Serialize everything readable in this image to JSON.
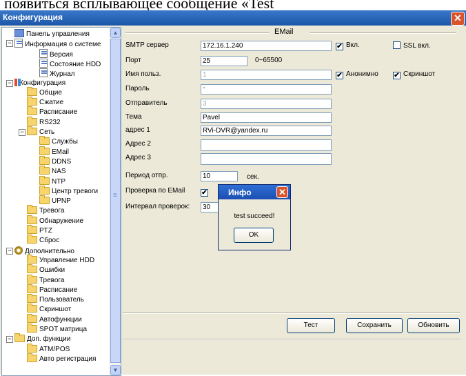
{
  "document_text": "появиться всплывающее сообщение «Test",
  "window": {
    "title": "Конфигурация",
    "close_glyph": "✕"
  },
  "tree": [
    {
      "label": "Панель управления",
      "level": 0,
      "icon": "panel-icon",
      "expander": ""
    },
    {
      "label": "Информация о системе",
      "level": 0,
      "icon": "doc-icon",
      "expander": "−"
    },
    {
      "label": "Версия",
      "level": 2,
      "icon": "doc-icon",
      "expander": ""
    },
    {
      "label": "Состояние HDD",
      "level": 2,
      "icon": "doc-icon",
      "expander": ""
    },
    {
      "label": "Журнал",
      "level": 2,
      "icon": "doc-icon",
      "expander": ""
    },
    {
      "label": "Конфигурация",
      "level": 0,
      "icon": "config-icon",
      "expander": "−"
    },
    {
      "label": "Общие",
      "level": 1,
      "icon": "folder",
      "expander": ""
    },
    {
      "label": "Сжатие",
      "level": 1,
      "icon": "folder",
      "expander": ""
    },
    {
      "label": "Расписание",
      "level": 1,
      "icon": "folder",
      "expander": ""
    },
    {
      "label": "RS232",
      "level": 1,
      "icon": "folder",
      "expander": ""
    },
    {
      "label": "Сеть",
      "level": 1,
      "icon": "folder",
      "expander": "−"
    },
    {
      "label": "Службы",
      "level": 2,
      "icon": "folder",
      "expander": ""
    },
    {
      "label": "EMail",
      "level": 2,
      "icon": "folder",
      "expander": ""
    },
    {
      "label": "DDNS",
      "level": 2,
      "icon": "folder",
      "expander": ""
    },
    {
      "label": "NAS",
      "level": 2,
      "icon": "folder",
      "expander": ""
    },
    {
      "label": "NTP",
      "level": 2,
      "icon": "folder",
      "expander": ""
    },
    {
      "label": "Центр тревоги",
      "level": 2,
      "icon": "folder",
      "expander": ""
    },
    {
      "label": "UPNP",
      "level": 2,
      "icon": "folder",
      "expander": ""
    },
    {
      "label": "Тревога",
      "level": 1,
      "icon": "folder",
      "expander": ""
    },
    {
      "label": "Обнаружение",
      "level": 1,
      "icon": "folder",
      "expander": ""
    },
    {
      "label": "PTZ",
      "level": 1,
      "icon": "folder",
      "expander": ""
    },
    {
      "label": "Сброс",
      "level": 1,
      "icon": "folder",
      "expander": ""
    },
    {
      "label": "Дополнительно",
      "level": 0,
      "icon": "gear-icon",
      "expander": "−"
    },
    {
      "label": "Управление HDD",
      "level": 1,
      "icon": "folder",
      "expander": ""
    },
    {
      "label": "Ошибки",
      "level": 1,
      "icon": "folder",
      "expander": ""
    },
    {
      "label": "Тревога",
      "level": 1,
      "icon": "folder",
      "expander": ""
    },
    {
      "label": "Расписание",
      "level": 1,
      "icon": "folder",
      "expander": ""
    },
    {
      "label": "Пользователь",
      "level": 1,
      "icon": "folder",
      "expander": ""
    },
    {
      "label": "Скриншот",
      "level": 1,
      "icon": "folder",
      "expander": ""
    },
    {
      "label": "Автофункции",
      "level": 1,
      "icon": "folder",
      "expander": ""
    },
    {
      "label": "SPOT матрица",
      "level": 1,
      "icon": "folder",
      "expander": ""
    },
    {
      "label": "Доп. функции",
      "level": 0,
      "icon": "folder",
      "expander": "−"
    },
    {
      "label": "ATM/POS",
      "level": 1,
      "icon": "folder",
      "expander": ""
    },
    {
      "label": "Авто регистрация",
      "level": 1,
      "icon": "folder",
      "expander": ""
    }
  ],
  "email": {
    "group_title": "EMail",
    "smtp": {
      "label": "SMTP сервер",
      "value": "172.16.1.240"
    },
    "port": {
      "label": "Порт",
      "value": "25",
      "hint": "0~65500"
    },
    "user": {
      "label": "Имя польз.",
      "value": "1"
    },
    "password": {
      "label": "Пароль",
      "value": "*"
    },
    "sender": {
      "label": "Отправитель",
      "value": "3"
    },
    "subject": {
      "label": "Тема",
      "value": "Pavel"
    },
    "addr1": {
      "label": "адрес 1",
      "value": "RVi-DVR@yandex.ru"
    },
    "addr2": {
      "label": "Адрес 2",
      "value": ""
    },
    "addr3": {
      "label": "Адрес 3",
      "value": ""
    },
    "period": {
      "label": "Период отпр.",
      "value": "10",
      "unit": "сек."
    },
    "check": {
      "label": "Проверка по EMail"
    },
    "interval": {
      "label": "Интервал проверок:",
      "value": "30"
    },
    "checkboxes": {
      "enable": {
        "label": "Вкл.",
        "checked": true
      },
      "ssl": {
        "label": "SSL вкл.",
        "checked": false
      },
      "anonymous": {
        "label": "Анонимно",
        "checked": true
      },
      "screenshot": {
        "label": "Скриншот",
        "checked": true
      }
    }
  },
  "buttons": {
    "test": "Тест",
    "save": "Сохранить",
    "refresh": "Обновить"
  },
  "dialog": {
    "title": "Инфо",
    "message": "test succeed!",
    "ok": "OK",
    "close_glyph": "✕"
  },
  "check_mark": "✔"
}
